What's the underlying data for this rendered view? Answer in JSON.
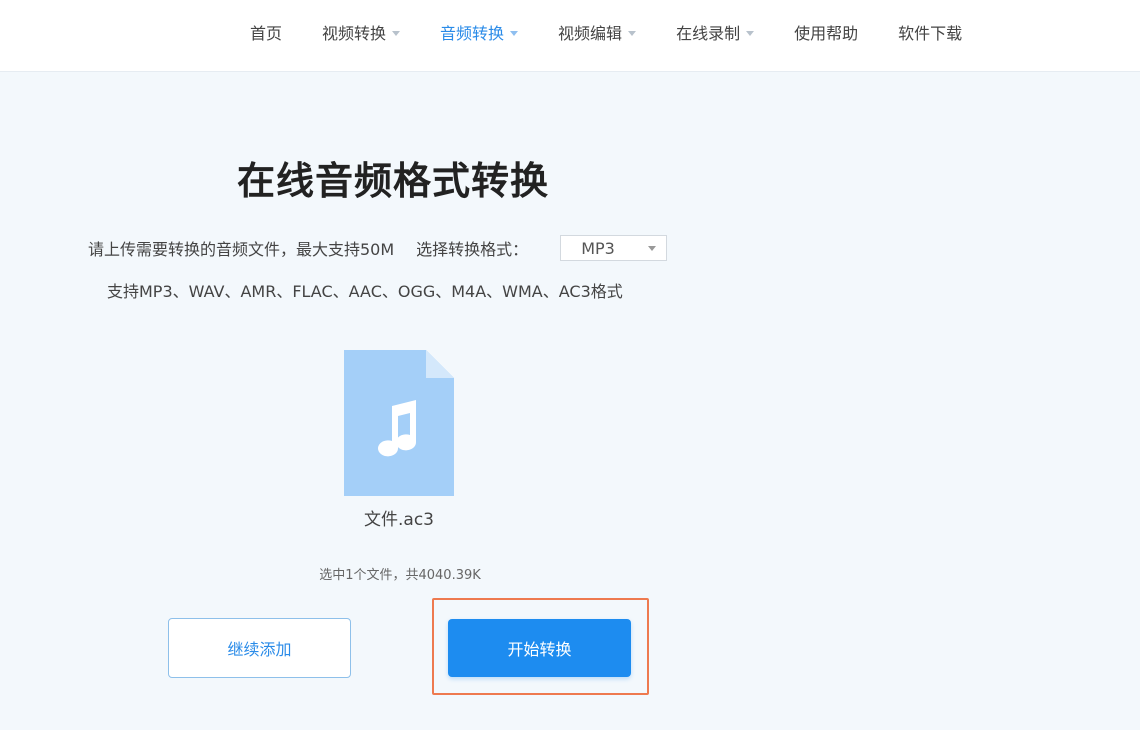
{
  "nav": {
    "items": [
      {
        "label": "首页",
        "dropdown": false,
        "active": false
      },
      {
        "label": "视频转换",
        "dropdown": true,
        "active": false
      },
      {
        "label": "音频转换",
        "dropdown": true,
        "active": true
      },
      {
        "label": "视频编辑",
        "dropdown": true,
        "active": false
      },
      {
        "label": "在线录制",
        "dropdown": true,
        "active": false
      },
      {
        "label": "使用帮助",
        "dropdown": false,
        "active": false
      },
      {
        "label": "软件下载",
        "dropdown": false,
        "active": false
      }
    ]
  },
  "main": {
    "title": "在线音频格式转换",
    "upload_hint": "请上传需要转换的音频文件，最大支持50M",
    "format_label": "选择转换格式：",
    "format_selected": "MP3",
    "supported_formats": "支持MP3、WAV、AMR、FLAC、AAC、OGG、M4A、WMA、AC3格式"
  },
  "file": {
    "icon": "music-file-icon",
    "name": "文件.ac3",
    "summary": "选中1个文件，共4040.39K"
  },
  "actions": {
    "continue_label": "继续添加",
    "start_label": "开始转换"
  },
  "colors": {
    "accent": "#1d8cf0",
    "active_nav": "#2a8be8",
    "file_icon": "#9ccaf7",
    "highlight": "#ee7a4f"
  }
}
